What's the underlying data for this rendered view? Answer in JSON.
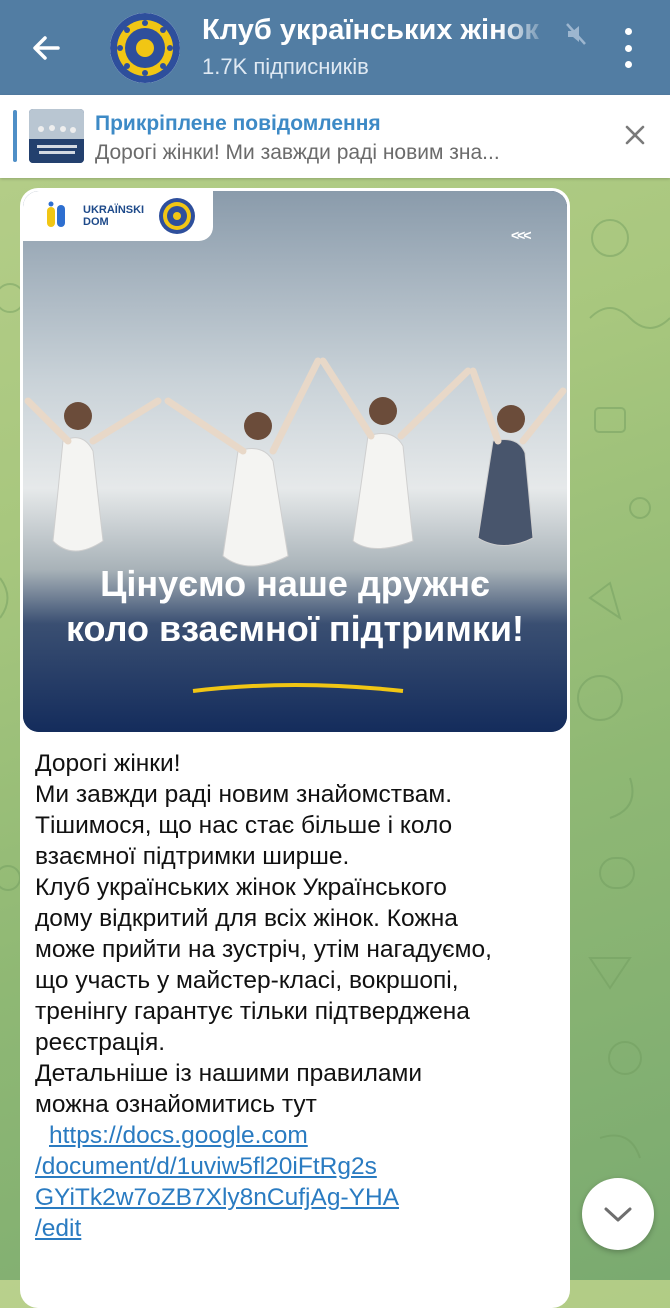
{
  "header": {
    "title": "Клуб українських жінок",
    "subtitle": "1.7K підписників"
  },
  "pinned": {
    "title": "Прикріплене повідомлення",
    "preview": "Дорогі жінки!  Ми завжди раді новим зна..."
  },
  "post": {
    "image": {
      "logo_text_line1": "UKRAÏNSKI",
      "logo_text_line2": "DOM",
      "headline_line1": "Цінуємо наше дружнє",
      "headline_line2": "коло взаємної підтримки!",
      "nav_marker": "<<<"
    },
    "lines": [
      "Дорогі жінки!",
      "Ми завжди раді новим знайомствам.",
      "Тішимося, що нас стає більше і коло",
      "взаємної підтримки ширше.",
      "Клуб українських жінок Українського",
      "дому відкритий для всіх жінок. Кожна",
      "може прийти на зустріч, утім нагадуємо,",
      "що участь у майстер-класі, вокршопі,",
      "тренінгу гарантує тільки підтверджена",
      "реєстрація.",
      "Детальніше із нашими правилами",
      "можна ознайомитись тут"
    ],
    "link_lines": [
      "https://docs.google.com",
      "/document/d/1uviw5fl20iFtRg2s",
      "GYiTk2w7oZB7Xly8nCufjAg-YHA",
      "/edit"
    ]
  },
  "colors": {
    "header_bg": "#527da3",
    "accent": "#3d8ac6",
    "link": "#2a7bc1"
  },
  "icons": [
    "back-arrow-icon",
    "channel-avatar",
    "muted-icon",
    "more-vert-icon",
    "close-icon",
    "chevron-down-icon"
  ]
}
